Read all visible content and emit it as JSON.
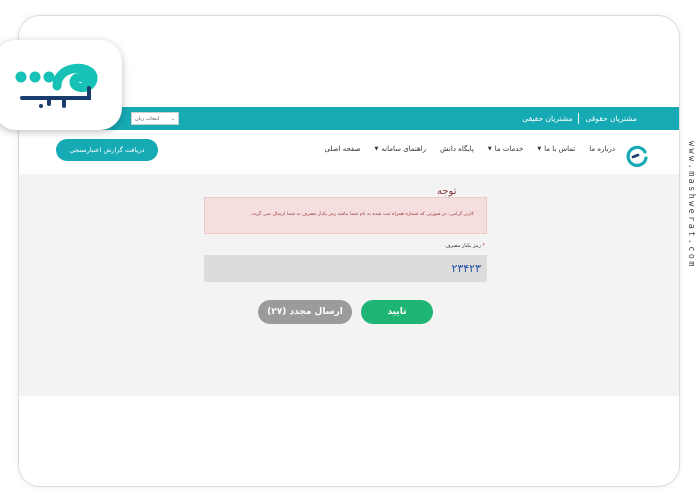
{
  "watermark": {
    "brand_logo_icon": "moshaverat-logo-icon",
    "side_text": "www.mashwerat.com"
  },
  "topbar": {
    "links": [
      "مشتریان حقیقی",
      "مشتریان حقوقی"
    ],
    "language_select": "انتخاب زبان",
    "color": "#16aab5"
  },
  "nav": {
    "items": [
      {
        "label": "صفحه اصلی",
        "has_dropdown": false
      },
      {
        "label": "راهنمای سامانه",
        "has_dropdown": true
      },
      {
        "label": "پایگاه دانش",
        "has_dropdown": false
      },
      {
        "label": "خدمات ما",
        "has_dropdown": true
      },
      {
        "label": "تماس با ما",
        "has_dropdown": true
      },
      {
        "label": "درباره ما",
        "has_dropdown": false
      }
    ],
    "report_button": "دریافت گزارش اعتبارسنجی",
    "logo_icon": "site-logo-icon"
  },
  "alert": {
    "title": "توجه",
    "message": "کاربر گرامی، در صورتی که شماره همراه ثبت شده به نام شما نباشد رمز یکبار مصرف به شما ارسال نمی گردد.",
    "bg_color": "#f4dede"
  },
  "otp": {
    "label": "رمز یکبار مصرف",
    "required_mark": "*",
    "value": "۲۳۴۲۳"
  },
  "buttons": {
    "confirm": "تایید",
    "resend": "ارسال مجدد (۲۷)",
    "confirm_color": "#1eb574",
    "resend_color": "#9b9b9b"
  }
}
